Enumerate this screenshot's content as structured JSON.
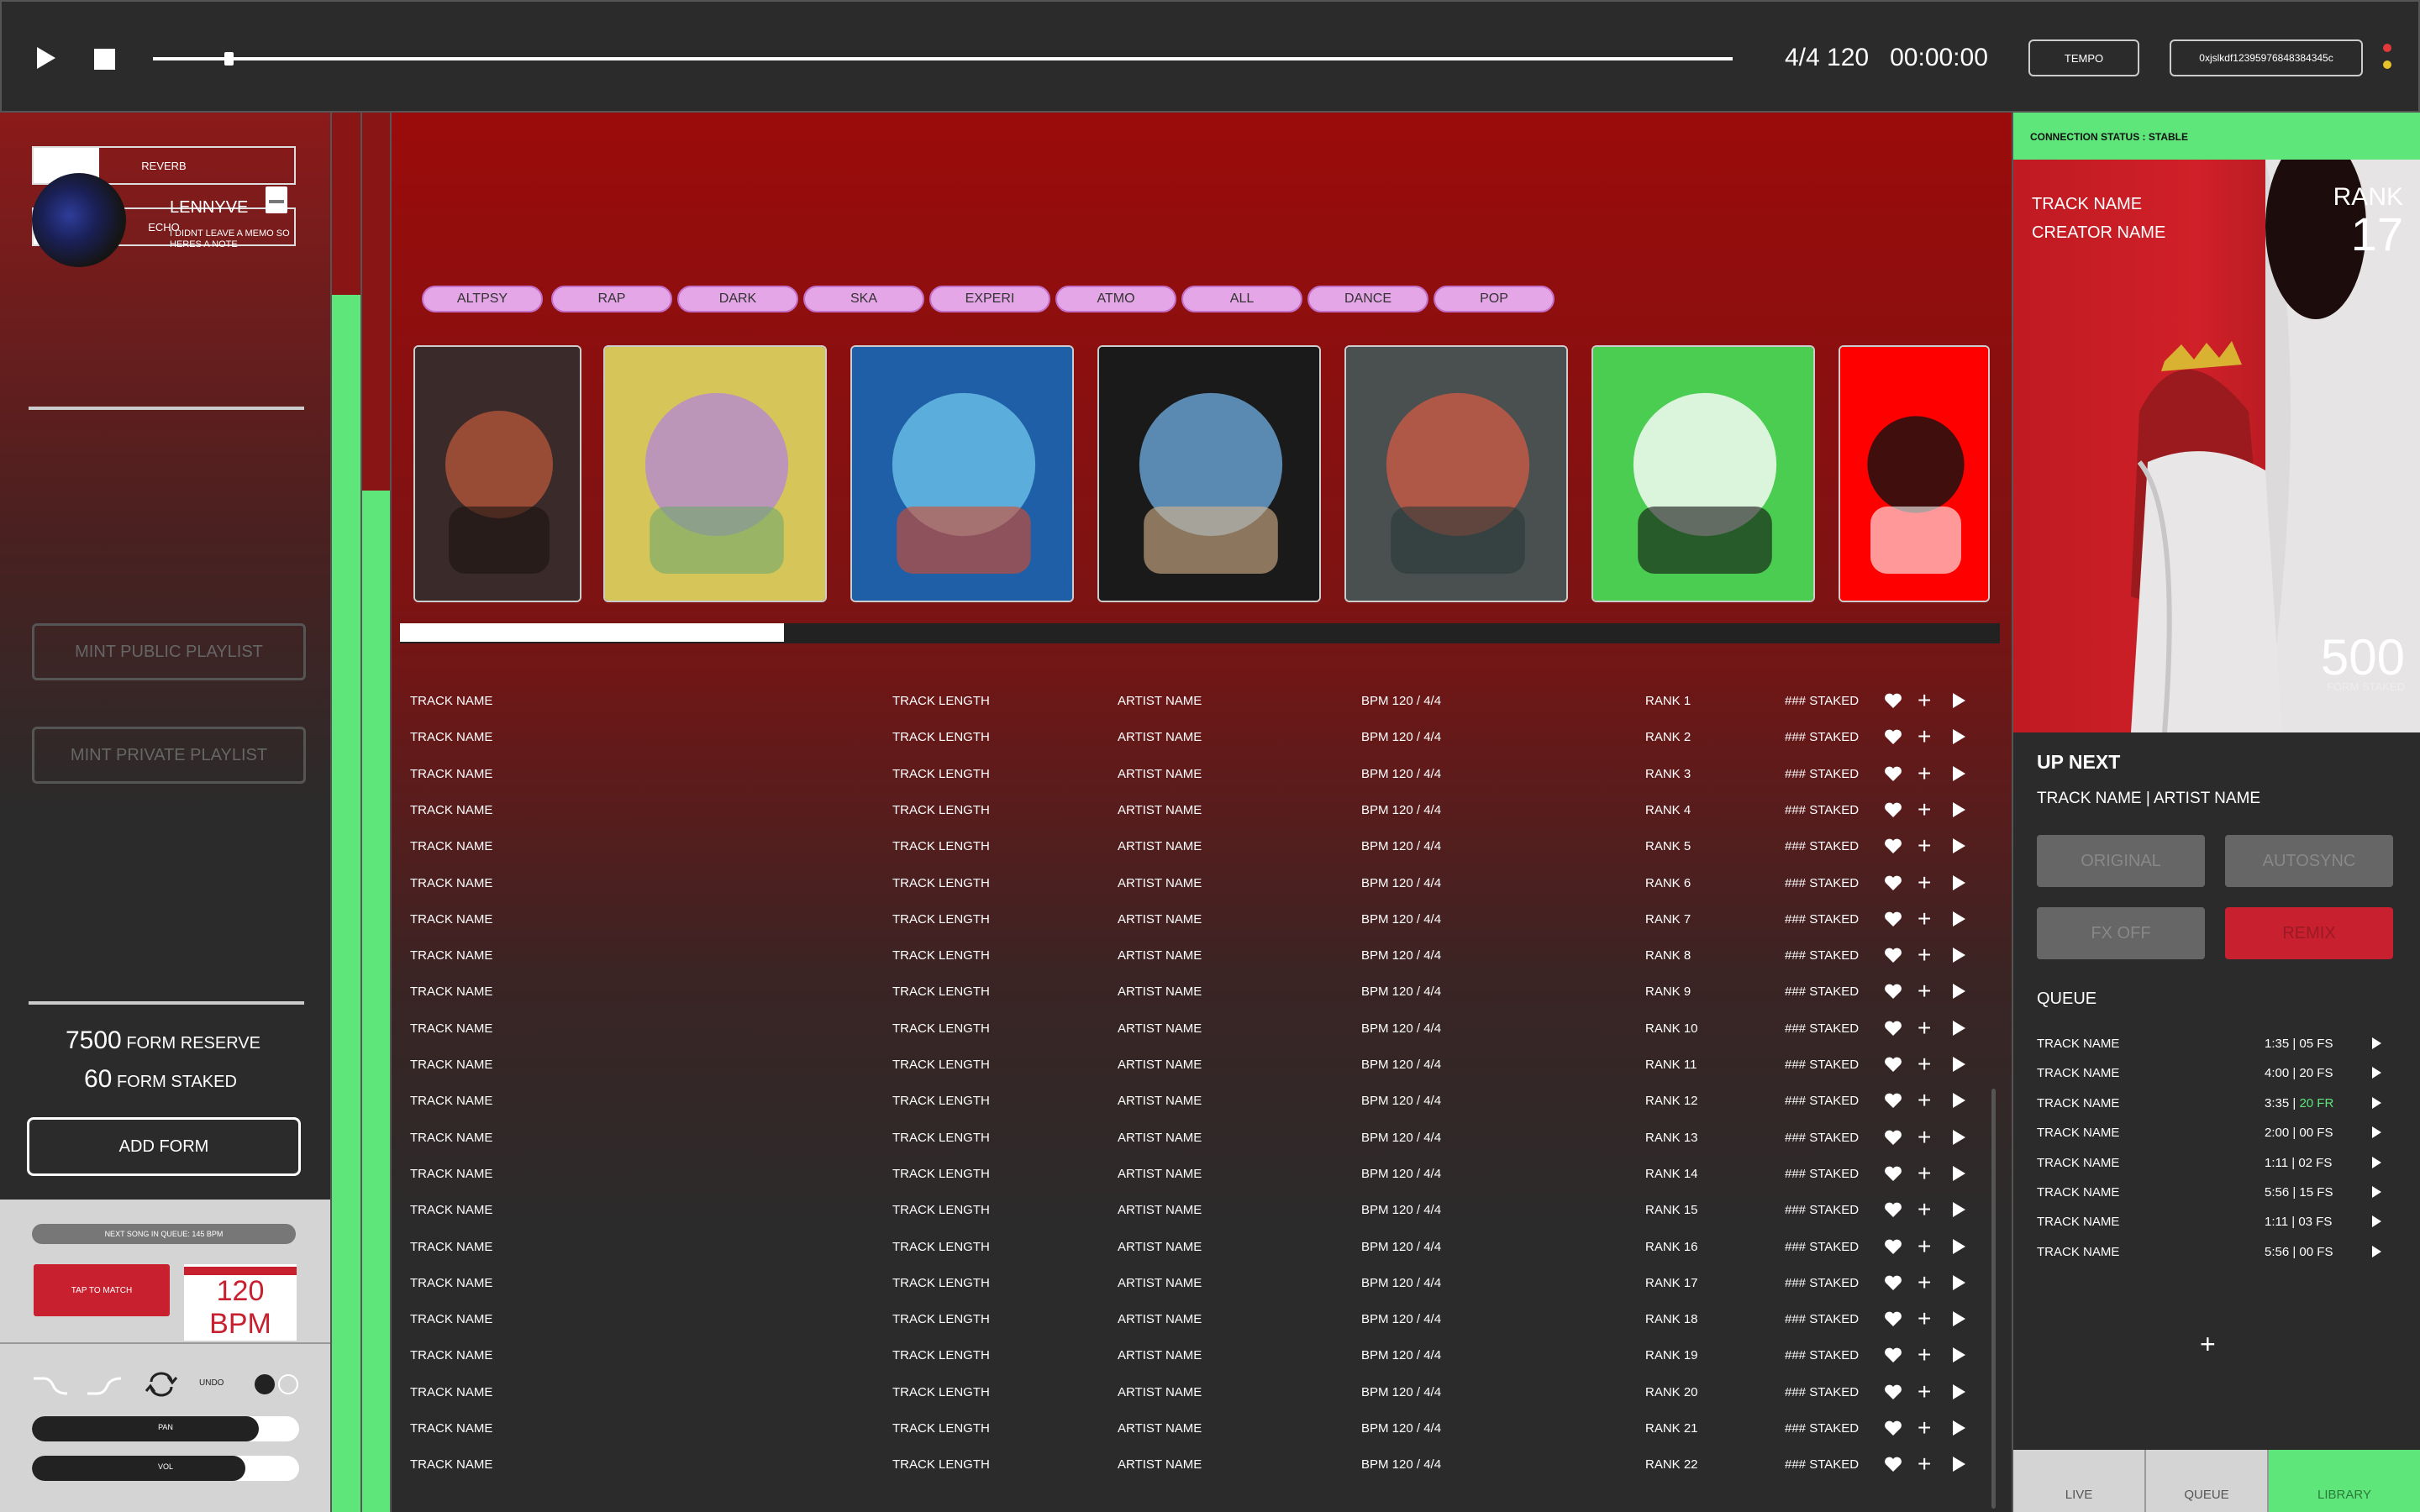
{
  "transport": {
    "time_signature_tempo": "4/4 120",
    "timecode": "00:00:00",
    "position": 0.045,
    "tempo_label": "TEMPO",
    "wallet_address": "0xjslkdf12395976848384345c"
  },
  "status_dots": [
    "#e23a3a",
    "#e8c22b"
  ],
  "left": {
    "fx": [
      {
        "label": "REVERB",
        "level": 0.25
      },
      {
        "label": "ECHO",
        "level": 0.02
      }
    ],
    "user": {
      "name": "LENNYVE",
      "note": "I DIDNT LEAVE A MEMO SO HERES A NOTE"
    },
    "mint_public": "MINT PUBLIC PLAYLIST",
    "mint_private": "MINT PRIVATE PLAYLIST",
    "reserve_value": "7500",
    "reserve_label": "FORM RESERVE",
    "staked_value": "60",
    "staked_label": "FORM STAKED",
    "add_form": "ADD FORM",
    "next_song_bpm": "NEXT SONG IN QUEUE: 145 BPM",
    "tap_to_match": "TAP TO MATCH",
    "bpm_display": "120 BPM",
    "undo_label": "UNDO",
    "pan": {
      "label": "PAN",
      "level": 0.85
    },
    "vol": {
      "label": "VOL",
      "level": 0.8
    }
  },
  "strips": [
    {
      "name": "level-strip-a",
      "color": "#5ee67a",
      "level": 0.87
    },
    {
      "name": "level-strip-b",
      "color": "#5ee67a",
      "level": 0.73
    }
  ],
  "main": {
    "genres": [
      "ALTPSY",
      "RAP",
      "DARK",
      "SKA",
      "EXPERI",
      "ATMO",
      "ALL",
      "DANCE",
      "POP"
    ],
    "covers": [
      {
        "name": "album-cover-1",
        "colors": [
          "#3a2a2a",
          "#b0553a",
          "#1a1410"
        ]
      },
      {
        "name": "album-cover-2",
        "colors": [
          "#d6c65a",
          "#b58ad0",
          "#6ea86a"
        ]
      },
      {
        "name": "album-cover-3",
        "colors": [
          "#1e5fa8",
          "#6ac0e8",
          "#d84a2a"
        ]
      },
      {
        "name": "album-cover-4",
        "colors": [
          "#1a1a1a",
          "#6aa6d8",
          "#d8b48a"
        ]
      },
      {
        "name": "album-cover-5",
        "colors": [
          "#4a5050",
          "#c85a46",
          "#2a3838"
        ]
      },
      {
        "name": "album-cover-6",
        "colors": [
          "#4acd50",
          "#ffffff",
          "#111111"
        ]
      },
      {
        "name": "album-cover-7",
        "colors": [
          "#ff0000",
          "#111111",
          "#ffffff"
        ]
      }
    ],
    "carousel_scroll": 0.24,
    "tracks": [
      {
        "name": "TRACK NAME",
        "length": "TRACK LENGTH",
        "artist": "ARTIST NAME",
        "bpm": "BPM 120 / 4/4",
        "rank": "RANK 1",
        "staked": "### STAKED"
      },
      {
        "name": "TRACK NAME",
        "length": "TRACK LENGTH",
        "artist": "ARTIST NAME",
        "bpm": "BPM 120 / 4/4",
        "rank": "RANK 2",
        "staked": "### STAKED"
      },
      {
        "name": "TRACK NAME",
        "length": "TRACK LENGTH",
        "artist": "ARTIST NAME",
        "bpm": "BPM 120 / 4/4",
        "rank": "RANK 3",
        "staked": "### STAKED"
      },
      {
        "name": "TRACK NAME",
        "length": "TRACK LENGTH",
        "artist": "ARTIST NAME",
        "bpm": "BPM 120 / 4/4",
        "rank": "RANK 4",
        "staked": "### STAKED"
      },
      {
        "name": "TRACK NAME",
        "length": "TRACK LENGTH",
        "artist": "ARTIST NAME",
        "bpm": "BPM 120 / 4/4",
        "rank": "RANK 5",
        "staked": "### STAKED"
      },
      {
        "name": "TRACK NAME",
        "length": "TRACK LENGTH",
        "artist": "ARTIST NAME",
        "bpm": "BPM 120 / 4/4",
        "rank": "RANK 6",
        "staked": "### STAKED"
      },
      {
        "name": "TRACK NAME",
        "length": "TRACK LENGTH",
        "artist": "ARTIST NAME",
        "bpm": "BPM 120 / 4/4",
        "rank": "RANK 7",
        "staked": "### STAKED"
      },
      {
        "name": "TRACK NAME",
        "length": "TRACK LENGTH",
        "artist": "ARTIST NAME",
        "bpm": "BPM 120 / 4/4",
        "rank": "RANK 8",
        "staked": "### STAKED"
      },
      {
        "name": "TRACK NAME",
        "length": "TRACK LENGTH",
        "artist": "ARTIST NAME",
        "bpm": "BPM 120 / 4/4",
        "rank": "RANK 9",
        "staked": "### STAKED"
      },
      {
        "name": "TRACK NAME",
        "length": "TRACK LENGTH",
        "artist": "ARTIST NAME",
        "bpm": "BPM 120 / 4/4",
        "rank": "RANK 10",
        "staked": "### STAKED"
      },
      {
        "name": "TRACK NAME",
        "length": "TRACK LENGTH",
        "artist": "ARTIST NAME",
        "bpm": "BPM 120 / 4/4",
        "rank": "RANK 11",
        "staked": "### STAKED"
      },
      {
        "name": "TRACK NAME",
        "length": "TRACK LENGTH",
        "artist": "ARTIST NAME",
        "bpm": "BPM 120 / 4/4",
        "rank": "RANK 12",
        "staked": "### STAKED"
      },
      {
        "name": "TRACK NAME",
        "length": "TRACK LENGTH",
        "artist": "ARTIST NAME",
        "bpm": "BPM 120 / 4/4",
        "rank": "RANK 13",
        "staked": "### STAKED"
      },
      {
        "name": "TRACK NAME",
        "length": "TRACK LENGTH",
        "artist": "ARTIST NAME",
        "bpm": "BPM 120 / 4/4",
        "rank": "RANK 14",
        "staked": "### STAKED"
      },
      {
        "name": "TRACK NAME",
        "length": "TRACK LENGTH",
        "artist": "ARTIST NAME",
        "bpm": "BPM 120 / 4/4",
        "rank": "RANK 15",
        "staked": "### STAKED"
      },
      {
        "name": "TRACK NAME",
        "length": "TRACK LENGTH",
        "artist": "ARTIST NAME",
        "bpm": "BPM 120 / 4/4",
        "rank": "RANK 16",
        "staked": "### STAKED"
      },
      {
        "name": "TRACK NAME",
        "length": "TRACK LENGTH",
        "artist": "ARTIST NAME",
        "bpm": "BPM 120 / 4/4",
        "rank": "RANK 17",
        "staked": "### STAKED"
      },
      {
        "name": "TRACK NAME",
        "length": "TRACK LENGTH",
        "artist": "ARTIST NAME",
        "bpm": "BPM 120 / 4/4",
        "rank": "RANK 18",
        "staked": "### STAKED"
      },
      {
        "name": "TRACK NAME",
        "length": "TRACK LENGTH",
        "artist": "ARTIST NAME",
        "bpm": "BPM 120 / 4/4",
        "rank": "RANK 19",
        "staked": "### STAKED"
      },
      {
        "name": "TRACK NAME",
        "length": "TRACK LENGTH",
        "artist": "ARTIST NAME",
        "bpm": "BPM 120 / 4/4",
        "rank": "RANK 20",
        "staked": "### STAKED"
      },
      {
        "name": "TRACK NAME",
        "length": "TRACK LENGTH",
        "artist": "ARTIST NAME",
        "bpm": "BPM 120 / 4/4",
        "rank": "RANK 21",
        "staked": "### STAKED"
      },
      {
        "name": "TRACK NAME",
        "length": "TRACK LENGTH",
        "artist": "ARTIST NAME",
        "bpm": "BPM 120 / 4/4",
        "rank": "RANK 22",
        "staked": "### STAKED"
      }
    ]
  },
  "right": {
    "connection_status": "CONNECTION STATUS : STABLE",
    "featured": {
      "track_name": "TRACK NAME",
      "creator_name": "CREATOR NAME",
      "rank_label": "RANK",
      "rank": "17",
      "staked_value": "500",
      "staked_label": "FORM STAKED"
    },
    "up_next_title": "UP NEXT",
    "up_next_track": "TRACK NAME | ARTIST NAME",
    "modes": [
      {
        "label": "ORIGINAL",
        "color": "#666666",
        "text": "#888888"
      },
      {
        "label": "AUTOSYNC",
        "color": "#666666",
        "text": "#888888"
      },
      {
        "label": "FX OFF",
        "color": "#666666",
        "text": "#888888"
      },
      {
        "label": "REMIX",
        "color": "#c8202f",
        "text": "#9a1a24"
      }
    ],
    "queue_title": "QUEUE",
    "queue": [
      {
        "name": "TRACK NAME",
        "time": "1:35 | 05 FS",
        "accent": ""
      },
      {
        "name": "TRACK NAME",
        "time": "4:00 | 20 FS",
        "accent": ""
      },
      {
        "name": "TRACK NAME",
        "time": "3:35 | ",
        "accent": "20 FR"
      },
      {
        "name": "TRACK NAME",
        "time": "2:00 | 00 FS",
        "accent": ""
      },
      {
        "name": "TRACK NAME",
        "time": "1:11 | 02 FS",
        "accent": ""
      },
      {
        "name": "TRACK NAME",
        "time": "5:56 | 15 FS",
        "accent": ""
      },
      {
        "name": "TRACK NAME",
        "time": "1:11 | 03 FS",
        "accent": ""
      },
      {
        "name": "TRACK NAME",
        "time": "5:56 | 00 FS",
        "accent": ""
      }
    ],
    "tabs": [
      {
        "label": "LIVE",
        "active": false
      },
      {
        "label": "QUEUE",
        "active": false
      },
      {
        "label": "LIBRARY",
        "active": true
      }
    ],
    "accent_green": "#5ee67a",
    "accent_red": "#c8202f"
  }
}
